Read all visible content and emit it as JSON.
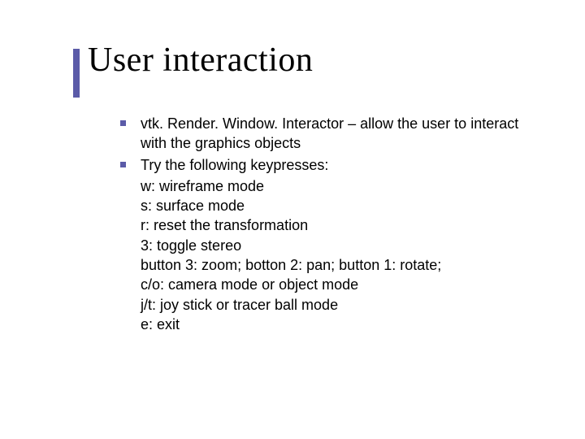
{
  "title": "User interaction",
  "bullets": [
    {
      "text": "vtk. Render. Window. Interactor – allow the user to interact with the graphics objects"
    },
    {
      "text": "Try the following keypresses:"
    }
  ],
  "sublines": [
    "w: wireframe mode",
    "s: surface mode",
    "r: reset the transformation",
    "3: toggle stereo",
    "button 3: zoom; botton 2: pan; button 1: rotate;",
    "c/o: camera mode or object mode",
    "j/t: joy stick or tracer ball mode",
    "e: exit"
  ]
}
